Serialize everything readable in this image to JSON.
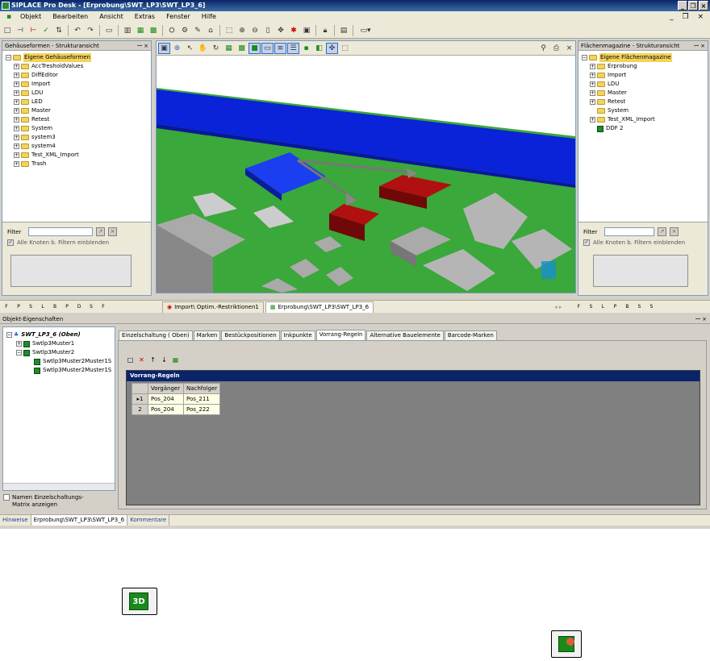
{
  "window": {
    "title": "SIPLACE Pro Desk - [Erprobung\\SWT_LP3\\SWT_LP3_6]"
  },
  "menu": [
    "Objekt",
    "Bearbeiten",
    "Ansicht",
    "Extras",
    "Fenster",
    "Hilfe"
  ],
  "left_panel": {
    "title": "Gehäuseformen - Strukturansicht",
    "root": "Eigene Gehäuseformen",
    "items": [
      "AccTresholdValues",
      "DiffEditor",
      "Import",
      "LDU",
      "LED",
      "Master",
      "Retest",
      "System",
      "system3",
      "system4",
      "Test_XML_Import",
      "Trash"
    ],
    "filter_label": "Filter",
    "filter_checkbox": "Alle Knoten b. Filtern einblenden"
  },
  "right_panel": {
    "title": "Flächenmagazine - Strukturansicht",
    "root": "Eigene Flächenmagazine",
    "items": [
      "Erprobung",
      "Import",
      "LDU",
      "Master",
      "Retest",
      "System",
      "Test_XML_Import",
      "DDF 2"
    ],
    "filter_label": "Filter",
    "filter_checkbox": "Alle Knoten b. Filtern einblenden"
  },
  "doc_tabs": [
    "Import\\ Optim.-Restriktionen1",
    "Erprobung\\SWT_LP3\\SWT_LP3_6"
  ],
  "tool_icons_left": [
    "F",
    "P",
    "S",
    "L",
    "B",
    "P",
    "D",
    "S",
    "F"
  ],
  "tool_icons_right": [
    "F",
    "S",
    "L",
    "P",
    "B",
    "S",
    "S"
  ],
  "props": {
    "title": "Objekt-Eigenschaften",
    "tree": [
      {
        "label": "SWT_LP3_6 (Oben)",
        "level": 0
      },
      {
        "label": "Swtlp3Muster1",
        "level": 1
      },
      {
        "label": "Swtlp3Muster2",
        "level": 1
      },
      {
        "label": "Swtlp3Muster2Muster1S",
        "level": 2
      },
      {
        "label": "Swtlp3Muster2Muster1S",
        "level": 2
      }
    ],
    "checkbox_label": "Namen Einzelschaltungs-Matrix anzeigen",
    "tabs": [
      "Einzelschaltung ( Oben)",
      "Marken",
      "Bestückpositionen",
      "Inkpunkte",
      "Vorrang-Regeln",
      "Alternative Bauelemente",
      "Barcode-Marken"
    ],
    "active_tab": "Vorrang-Regeln",
    "grid_title": "Vorrang-Regeln",
    "columns": [
      "Vorgänger",
      "Nachfolger"
    ],
    "rows": [
      {
        "num": "1",
        "vorgaenger": "Pos_204",
        "nachfolger": "Pos_211"
      },
      {
        "num": "2",
        "vorgaenger": "Pos_204",
        "nachfolger": "Pos_222"
      }
    ]
  },
  "status_tabs": [
    "Hinweise",
    "Erprobung\\SWT_LP3\\SWT_LP3_6",
    "Kommentare"
  ],
  "bottom_icons": {
    "icon1": "3D",
    "icon2": "rule-icon"
  }
}
